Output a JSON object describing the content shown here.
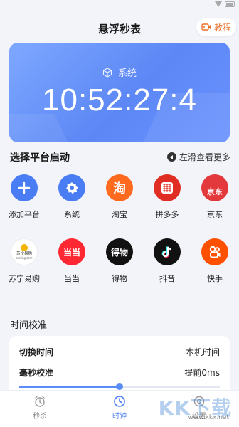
{
  "header": {
    "title": "悬浮秒表",
    "tutorial_label": "教程"
  },
  "clock": {
    "source_label": "系统",
    "time": "10:52:27:4"
  },
  "platforms": {
    "section_title": "选择平台启动",
    "swipe_hint": "左滑查看更多",
    "items": [
      {
        "label": "添加平台",
        "icon": "plus-icon",
        "color": "#4a7cf3"
      },
      {
        "label": "系统",
        "icon": "gear-icon",
        "color": "#4a7cf3"
      },
      {
        "label": "淘宝",
        "icon": "taobao-logo",
        "color": "#ff6a1f",
        "glyph": "淘"
      },
      {
        "label": "拼多多",
        "icon": "pinduoduo-logo",
        "color": "#e02e24"
      },
      {
        "label": "京东",
        "icon": "jd-logo",
        "color": "#e4393c",
        "glyph": "京东"
      },
      {
        "label": "苏宁易购",
        "icon": "suning-logo",
        "color": "#ffffff",
        "glyph": "苏宁易购",
        "glyph_sub": "suning.com"
      },
      {
        "label": "当当",
        "icon": "dangdang-logo",
        "color": "#ff2832",
        "glyph": "当当"
      },
      {
        "label": "得物",
        "icon": "dewu-logo",
        "color": "#111111",
        "glyph": "得物"
      },
      {
        "label": "抖音",
        "icon": "douyin-logo",
        "color": "#111111"
      },
      {
        "label": "快手",
        "icon": "kuaishou-logo",
        "color": "#ff5000"
      }
    ]
  },
  "calibration": {
    "section_title": "时间校准",
    "switch_time_label": "切换时间",
    "switch_time_value": "本机时间",
    "ms_calib_label": "毫秒校准",
    "ms_calib_value": "提前0ms",
    "slider_level": 0.5
  },
  "tabs": [
    {
      "label": "秒杀",
      "icon": "alarm-clock-icon"
    },
    {
      "label": "时钟",
      "icon": "clock-icon",
      "active": true
    },
    {
      "label": "设置",
      "icon": "settings-icon"
    }
  ],
  "watermark": {
    "text": "KK下载",
    "url": "www.kkx.net"
  },
  "colors": {
    "accent": "#4a7cf3",
    "tutorial": "#e8702a"
  }
}
